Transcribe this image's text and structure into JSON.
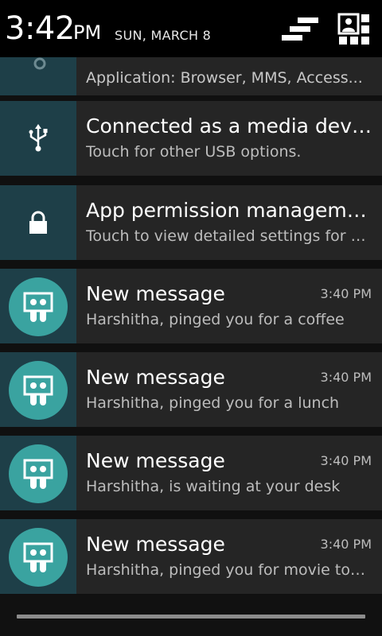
{
  "status": {
    "time": "3:42",
    "ampm": "PM",
    "date": "SUN, MARCH 8"
  },
  "icons": {
    "clear": "clear-all-icon",
    "settings": "quick-settings-icon",
    "usb": "usb-icon",
    "lock": "lock-icon",
    "app": "chat-app-icon"
  },
  "colors": {
    "icon_box": "#1e3f48",
    "app_circle": "#3aa3a0",
    "card": "#252525"
  },
  "notifications": [
    {
      "text": "Application: Browser, MMS, Access..."
    },
    {
      "title": "Connected as a media device",
      "text": "Touch for other USB options."
    },
    {
      "title": "App permission manageme...",
      "text": "Touch to view detailed settings for a..."
    },
    {
      "title": "New message",
      "time": "3:40 PM",
      "text": "Harshitha, pinged you for a coffee"
    },
    {
      "title": "New message",
      "time": "3:40 PM",
      "text": "Harshitha, pinged you for a lunch"
    },
    {
      "title": "New message",
      "time": "3:40 PM",
      "text": "Harshitha, is waiting at your desk"
    },
    {
      "title": "New message",
      "time": "3:40 PM",
      "text": "Harshitha, pinged you for movie toni..."
    }
  ]
}
